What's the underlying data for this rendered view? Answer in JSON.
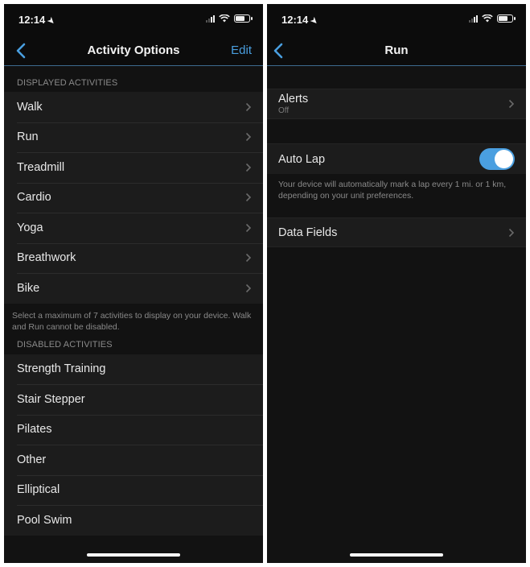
{
  "status_bar": {
    "time": "12:14",
    "location_icon": "location-arrow-icon",
    "signal_bars_active": 2,
    "signal_bars_total": 4,
    "wifi_icon": "wifi-icon",
    "battery_icon": "battery-icon"
  },
  "left_screen": {
    "nav": {
      "back_icon": "chevron-left-icon",
      "title": "Activity Options",
      "edit_label": "Edit"
    },
    "displayed_header": "DISPLAYED ACTIVITIES",
    "displayed_activities": [
      {
        "label": "Walk"
      },
      {
        "label": "Run"
      },
      {
        "label": "Treadmill"
      },
      {
        "label": "Cardio"
      },
      {
        "label": "Yoga"
      },
      {
        "label": "Breathwork"
      },
      {
        "label": "Bike"
      }
    ],
    "footnote": "Select a maximum of 7 activities to display on your device. Walk and Run cannot be disabled.",
    "disabled_header": "DISABLED ACTIVITIES",
    "disabled_activities": [
      {
        "label": "Strength Training"
      },
      {
        "label": "Stair Stepper"
      },
      {
        "label": "Pilates"
      },
      {
        "label": "Other"
      },
      {
        "label": "Elliptical"
      },
      {
        "label": "Pool Swim"
      }
    ]
  },
  "right_screen": {
    "nav": {
      "back_icon": "chevron-left-icon",
      "title": "Run"
    },
    "alerts": {
      "label": "Alerts",
      "value": "Off"
    },
    "auto_lap": {
      "label": "Auto Lap",
      "enabled": true,
      "description": "Your device will automatically mark a lap every 1 mi. or 1 km, depending on your unit preferences."
    },
    "data_fields": {
      "label": "Data Fields"
    }
  },
  "colors": {
    "accent": "#4a9fe0",
    "background": "#121212",
    "cell": "#1c1c1c",
    "nav_divider": "#3d6a8f"
  }
}
